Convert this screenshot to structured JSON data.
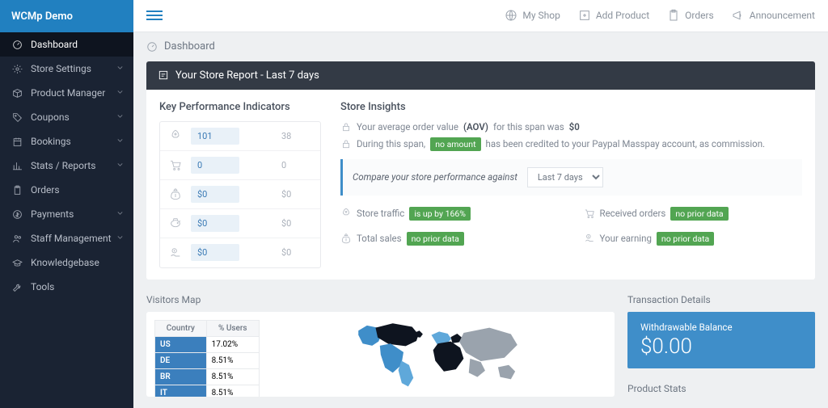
{
  "brand": "WCMp Demo",
  "sidebar": {
    "items": [
      {
        "label": "Dashboard",
        "icon": "gauge-icon",
        "active": true,
        "expandable": false
      },
      {
        "label": "Store Settings",
        "icon": "gear-icon",
        "active": false,
        "expandable": true
      },
      {
        "label": "Product Manager",
        "icon": "box-icon",
        "active": false,
        "expandable": true
      },
      {
        "label": "Coupons",
        "icon": "tag-icon",
        "active": false,
        "expandable": true
      },
      {
        "label": "Bookings",
        "icon": "calendar-icon",
        "active": false,
        "expandable": true
      },
      {
        "label": "Stats / Reports",
        "icon": "chart-icon",
        "active": false,
        "expandable": true
      },
      {
        "label": "Orders",
        "icon": "clipboard-icon",
        "active": false,
        "expandable": false
      },
      {
        "label": "Payments",
        "icon": "dollar-icon",
        "active": false,
        "expandable": true
      },
      {
        "label": "Staff Management",
        "icon": "users-icon",
        "active": false,
        "expandable": true
      },
      {
        "label": "Knowledgebase",
        "icon": "cap-icon",
        "active": false,
        "expandable": false
      },
      {
        "label": "Tools",
        "icon": "wrench-icon",
        "active": false,
        "expandable": false
      }
    ]
  },
  "topbar": {
    "links": [
      {
        "label": "My Shop",
        "icon": "globe-icon"
      },
      {
        "label": "Add Product",
        "icon": "add-box-icon"
      },
      {
        "label": "Orders",
        "icon": "clipboard-icon"
      },
      {
        "label": "Announcement",
        "icon": "megaphone-icon"
      }
    ]
  },
  "breadcrumb": "Dashboard",
  "report": {
    "title": "Your Store Report - Last 7 days",
    "kpi_title": "Key Performance Indicators",
    "kpis": [
      {
        "icon": "rocket-icon",
        "val1": "101",
        "val2": "38"
      },
      {
        "icon": "cart-icon",
        "val1": "0",
        "val2": "0"
      },
      {
        "icon": "moneybag-icon",
        "val1": "$0",
        "val2": "$0"
      },
      {
        "icon": "piggy-icon",
        "val1": "$0",
        "val2": "$0"
      },
      {
        "icon": "handmoney-icon",
        "val1": "$0",
        "val2": "$0"
      }
    ],
    "insights_title": "Store Insights",
    "aov": {
      "pre": "Your average order value",
      "abbr": "(AOV)",
      "mid": "for this span was",
      "value": "$0"
    },
    "commission": {
      "pre": "During this span,",
      "badge": "no amount",
      "post": "has been credited to your Paypal Masspay account, as commission."
    },
    "compare": {
      "label": "Compare your store performance against",
      "selected": "Last 7 days"
    },
    "metrics": [
      {
        "icon": "rocket-icon",
        "label": "Store traffic",
        "badge": "is up by 166%"
      },
      {
        "icon": "cart-icon",
        "label": "Received orders",
        "badge": "no prior data"
      },
      {
        "icon": "moneybag-icon",
        "label": "Total sales",
        "badge": "no prior data"
      },
      {
        "icon": "handmoney-icon",
        "label": "Your earning",
        "badge": "no prior data"
      }
    ]
  },
  "visitors": {
    "title": "Visitors Map",
    "col1": "Country",
    "col2": "% Users",
    "rows": [
      {
        "code": "US",
        "pct": "17.02%"
      },
      {
        "code": "DE",
        "pct": "8.51%"
      },
      {
        "code": "BR",
        "pct": "8.51%"
      },
      {
        "code": "IT",
        "pct": "8.51%"
      }
    ]
  },
  "transaction": {
    "title": "Transaction Details",
    "balance_label": "Withdrawable Balance",
    "balance_value": "$0.00",
    "product_stats": "Product Stats"
  },
  "chart_data": {
    "type": "table",
    "title": "Visitors by Country (% Users)",
    "categories": [
      "US",
      "DE",
      "BR",
      "IT"
    ],
    "values": [
      17.02,
      8.51,
      8.51,
      8.51
    ],
    "xlabel": "Country",
    "ylabel": "% Users"
  }
}
